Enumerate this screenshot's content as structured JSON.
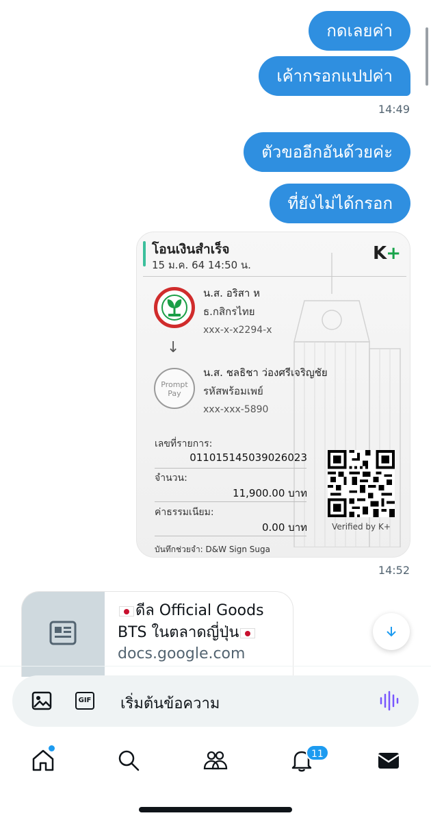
{
  "messages": [
    {
      "text": "กดเลยค่า"
    },
    {
      "text": "เค้ากรอกแปปค่า"
    },
    {
      "text": "ตัวขออีกอันด้วยค่ะ"
    },
    {
      "text": "ที่ยังไม่ได้กรอก"
    }
  ],
  "timestamps": {
    "first": "14:49",
    "receipt": "14:52"
  },
  "receipt": {
    "title": "โอนเงินสำเร็จ",
    "date": "15 ม.ค. 64  14:50 น.",
    "brand": "K",
    "brand_plus": "+",
    "sender": {
      "name": "น.ส. อริสา ห",
      "bank": "ธ.กสิกรไทย",
      "account": "xxx-x-x2294-x"
    },
    "arrow": "↓",
    "receiver": {
      "logo_line1": "Prompt",
      "logo_line2": "Pay",
      "name": "น.ส. ชลธิชา ว่องศรีเจริญชัย",
      "method": "รหัสพร้อมเพย์",
      "account": "xxx-xxx-5890"
    },
    "ref_label": "เลขที่รายการ:",
    "ref_value": "011015145039026023",
    "amount_label": "จำนวน:",
    "amount_value": "11,900.00 บาท",
    "fee_label": "ค่าธรรมเนียม:",
    "fee_value": "0.00 บาท",
    "verified": "Verified by K+",
    "memo": "บันทึกช่วยจำ: D&W Sign Suga"
  },
  "link_card": {
    "title_part1": "ดีล Official Goods BTS ในตลาดญี่ปุ่น",
    "url": "docs.google.com",
    "thumb_icon": "article-icon"
  },
  "composer": {
    "placeholder": "เริ่มต้นข้อความ",
    "gif_label": "GIF"
  },
  "nav": {
    "notifications_badge": "11"
  },
  "colors": {
    "bubble": "#2f8fe0",
    "accent": "#1d9bf0",
    "voice": "#7856ff"
  }
}
